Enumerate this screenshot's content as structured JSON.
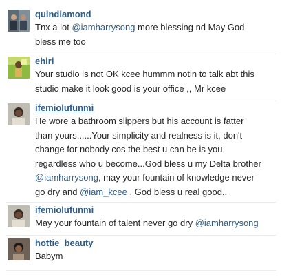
{
  "comments": [
    {
      "username": "quindiamond",
      "underline": false,
      "lines": [
        [
          {
            "t": "Tnx a lot ",
            "m": false
          },
          {
            "t": "@iamharrysong",
            "m": true
          },
          {
            "t": " more blessing nd May God",
            "m": false
          }
        ],
        [
          {
            "t": "bless me too",
            "m": false
          }
        ]
      ]
    },
    {
      "username": "ehiri",
      "underline": false,
      "lines": [
        [
          {
            "t": "Your studio is not OK kcee hummm notin to talk abt this",
            "m": false
          }
        ],
        [
          {
            "t": "studio make it look good is your office ,, Mr kcee",
            "m": false
          }
        ]
      ]
    },
    {
      "username": "ifemiolufunmi",
      "underline": true,
      "lines": [
        [
          {
            "t": "He wore a bathroom slippers but his account is fatter",
            "m": false
          }
        ],
        [
          {
            "t": "than yours......Your simplicity and realness is it, don't",
            "m": false
          }
        ],
        [
          {
            "t": "change for nobody cos the best u can be is you",
            "m": false
          }
        ],
        [
          {
            "t": "regardless who u become...God bless u my Delta brother",
            "m": false
          }
        ],
        [
          {
            "t": "@iamharrysong",
            "m": true
          },
          {
            "t": ", may your fountain of knowledge never",
            "m": false
          }
        ],
        [
          {
            "t": "go dry and ",
            "m": false
          },
          {
            "t": "@iam_kcee",
            "m": true
          },
          {
            "t": " , God bless u real good..",
            "m": false
          }
        ]
      ]
    },
    {
      "username": "ifemiolufunmi",
      "underline": false,
      "lines": [
        [
          {
            "t": "May your fountain of talent never go dry ",
            "m": false
          },
          {
            "t": "@iamharrysong",
            "m": true
          }
        ]
      ]
    },
    {
      "username": "hottie_beauty",
      "underline": false,
      "lines": [
        [
          {
            "t": "Babym",
            "m": false
          }
        ]
      ]
    }
  ]
}
